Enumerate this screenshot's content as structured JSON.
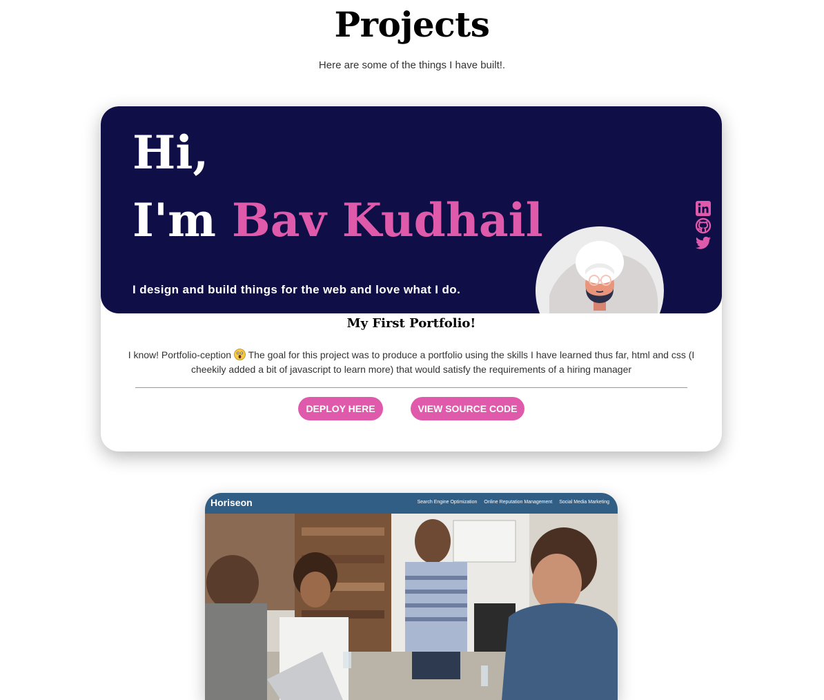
{
  "page": {
    "title": "Projects",
    "subtitle": "Here are some of the things I have built!."
  },
  "project1": {
    "hero": {
      "greeting": "Hi,",
      "intro": "I'm",
      "name": "Bav Kudhail",
      "tagline": "I design and build things for the web and love what I do."
    },
    "socials": [
      "linkedin-icon",
      "github-icon",
      "twitter-icon"
    ],
    "title": "My First Portfolio!",
    "description_before": "I know! Portfolio-ception",
    "description_after": "The goal for this project was to produce a portfolio using the skills I have learned thus far, html and css (I cheekily added a bit of javascript to learn more) that would satisfy the requirements of a hiring manager",
    "buttons": {
      "deploy": "DEPLOY HERE",
      "source": "VIEW SOURCE CODE"
    }
  },
  "project2": {
    "logo": "Horiseon",
    "nav": [
      "Search Engine Optimization",
      "Online Reputation Management",
      "Social Media Marketing"
    ]
  },
  "colors": {
    "hero_background": "#0f0e46",
    "accent_pink": "#e05aac",
    "horiseon_bar": "#315e85"
  }
}
